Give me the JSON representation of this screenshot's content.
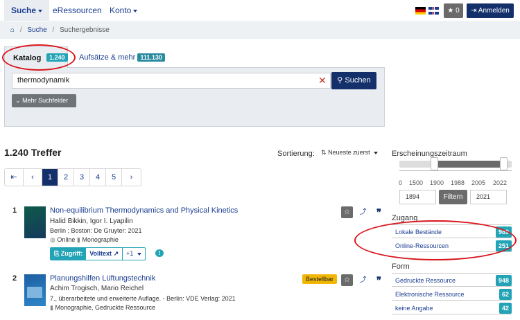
{
  "nav": {
    "search": "Suche",
    "eresources": "eRessourcen",
    "account": "Konto",
    "favorites_count": "0",
    "login": "Anmelden"
  },
  "breadcrumb": {
    "search": "Suche",
    "results": "Suchergebnisse"
  },
  "tabs": {
    "catalog": {
      "label": "Katalog",
      "count": "1.240"
    },
    "articles": {
      "label": "Aufsätze & mehr",
      "count": "111.130"
    }
  },
  "search": {
    "query": "thermodynamik",
    "button": "Suchen",
    "more_fields": "Mehr Suchfelder"
  },
  "results": {
    "count_label": "1.240 Treffer",
    "sort_label": "Sortierung:",
    "sort_value": "Neueste zuerst",
    "pages": [
      "1",
      "2",
      "3",
      "4",
      "5"
    ],
    "items": [
      {
        "num": "1",
        "title": "Non-equilibrium Thermodynamics and Physical Kinetics",
        "authors": "Halid Bikkin, Igor I. Lyapilin",
        "publisher": "Berlin ; Boston: De Gruyter: 2021",
        "format": "Online",
        "type": "Monographie",
        "access_label": "Zugriff:",
        "fulltext": "Volltext",
        "more": "+1"
      },
      {
        "num": "2",
        "title": "Planungshilfen Lüftungstechnik",
        "authors": "Achim Trogisch, Mario Reichel",
        "edition": "7., überarbeitete und erweiterte Auflage. - Berlin: VDE Verlag: 2021",
        "type": "Monographie, Gedruckte Ressource",
        "status": "Bestellbar"
      }
    ]
  },
  "facets": {
    "period": {
      "title": "Erscheinungszeitraum",
      "ticks": [
        "0",
        "1500",
        "1900",
        "1988",
        "2005",
        "2022"
      ],
      "from": "1894",
      "to": "2021",
      "filter_button": "Filtern"
    },
    "access": {
      "title": "Zugang",
      "items": [
        {
          "label": "Lokale Bestände",
          "count": "989"
        },
        {
          "label": "Online-Ressourcen",
          "count": "251"
        }
      ]
    },
    "form": {
      "title": "Form",
      "items": [
        {
          "label": "Gedruckte Ressource",
          "count": "948"
        },
        {
          "label": "Elektronische Ressource",
          "count": "62"
        },
        {
          "label": "keine Angabe",
          "count": "42"
        }
      ]
    }
  },
  "colors": {
    "primary": "#14306b",
    "accent": "#22a3b6",
    "annotation": "#d9141b",
    "status": "#f2b705"
  }
}
